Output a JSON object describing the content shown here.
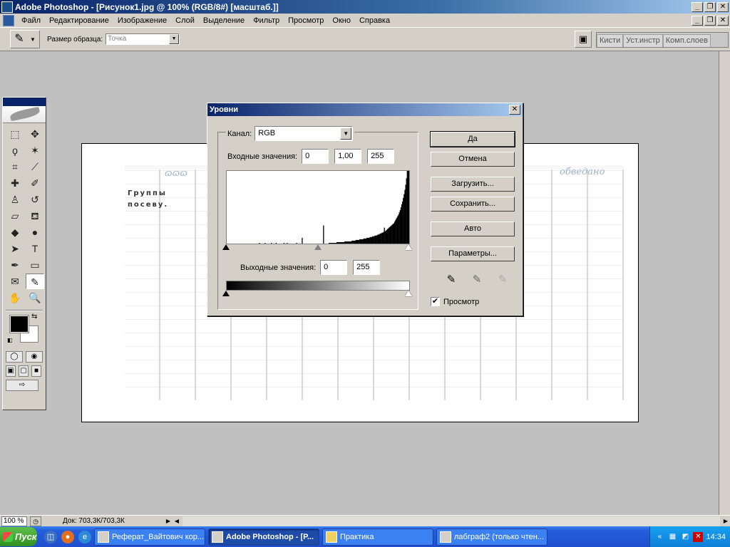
{
  "window": {
    "title": "Adobe Photoshop - [Рисунок1.jpg @ 100% (RGB/8#) [масштаб.]]",
    "minimize": "_",
    "restore": "❐",
    "close": "✕"
  },
  "menu": {
    "items": [
      "Файл",
      "Редактирование",
      "Изображение",
      "Слой",
      "Выделение",
      "Фильтр",
      "Просмотр",
      "Окно",
      "Справка"
    ]
  },
  "options": {
    "tool_icon": "eyedropper-icon",
    "tool_glyph": "✎",
    "sample_size_label": "Размер образца:",
    "sample_size_value": "Точка",
    "palette_tabs": [
      "Кисти",
      "Уст.инстр",
      "Комп.слоев"
    ]
  },
  "toolbox": {
    "tools": [
      {
        "name": "marquee-icon",
        "glyph": "⬚"
      },
      {
        "name": "move-icon",
        "glyph": "✥"
      },
      {
        "name": "lasso-icon",
        "glyph": "ϙ"
      },
      {
        "name": "magic-wand-icon",
        "glyph": "✶"
      },
      {
        "name": "crop-icon",
        "glyph": "⌗"
      },
      {
        "name": "slice-icon",
        "glyph": "⟋"
      },
      {
        "name": "healing-brush-icon",
        "glyph": "✚"
      },
      {
        "name": "brush-icon",
        "glyph": "✐"
      },
      {
        "name": "clone-stamp-icon",
        "glyph": "♙"
      },
      {
        "name": "history-brush-icon",
        "glyph": "↺"
      },
      {
        "name": "eraser-icon",
        "glyph": "▱"
      },
      {
        "name": "paint-bucket-icon",
        "glyph": "⛾"
      },
      {
        "name": "blur-icon",
        "glyph": "◆"
      },
      {
        "name": "dodge-icon",
        "glyph": "●"
      },
      {
        "name": "path-selection-icon",
        "glyph": "➤"
      },
      {
        "name": "type-icon",
        "glyph": "T"
      },
      {
        "name": "pen-icon",
        "glyph": "✒"
      },
      {
        "name": "rectangle-icon",
        "glyph": "▭"
      },
      {
        "name": "notes-icon",
        "glyph": "✉"
      },
      {
        "name": "eyedropper-tool-icon",
        "glyph": "✎",
        "active": true
      },
      {
        "name": "hand-icon",
        "glyph": "✋"
      },
      {
        "name": "zoom-icon",
        "glyph": "🔍"
      }
    ],
    "foreground_color": "#000000",
    "background_color": "#ffffff"
  },
  "document": {
    "scan_heading_1": "Группы",
    "scan_heading_2": "посеву.",
    "scan_script_left": "ɷɷɷ",
    "scan_script_right": "обведано"
  },
  "levels_dialog": {
    "title": "Уровни",
    "channel_label": "Канал:",
    "channel_value": "RGB",
    "input_label": "Входные значения:",
    "input_black": "0",
    "input_gamma": "1,00",
    "input_white": "255",
    "output_label": "Выходные значения:",
    "output_black": "0",
    "output_white": "255",
    "buttons": {
      "ok": "Да",
      "cancel": "Отмена",
      "load": "Загрузить...",
      "save": "Сохранить...",
      "auto": "Авто",
      "options": "Параметры..."
    },
    "preview_label": "Просмотр",
    "preview_checked": true,
    "histogram": [
      0,
      0,
      0,
      0,
      0,
      0,
      0,
      0,
      0,
      0,
      0,
      0,
      0,
      0,
      0,
      0,
      0,
      0,
      0,
      0,
      0,
      0,
      0,
      0,
      0,
      0,
      0,
      0,
      0,
      0,
      0,
      0,
      0,
      0,
      0,
      0,
      0,
      0,
      0,
      0,
      0,
      1,
      0,
      0,
      0,
      0,
      0,
      0,
      1,
      0,
      0,
      0,
      0,
      0,
      0,
      0,
      1,
      0,
      0,
      0,
      0,
      0,
      1,
      0,
      0,
      0,
      0,
      0,
      0,
      0,
      0,
      0,
      1,
      0,
      0,
      0,
      1,
      0,
      0,
      0,
      0,
      0,
      0,
      0,
      0,
      0,
      0,
      0,
      1,
      0,
      0,
      0,
      0,
      0,
      0,
      8,
      0,
      0,
      0,
      0,
      0,
      0,
      0,
      0,
      0,
      0,
      0,
      0,
      0,
      0,
      0,
      0,
      0,
      0,
      0,
      0,
      0,
      0,
      0,
      0,
      0,
      0,
      25,
      0,
      0,
      0,
      0,
      0,
      0,
      1,
      1,
      1,
      1,
      1,
      1,
      1,
      1,
      1,
      1,
      2,
      2,
      2,
      2,
      2,
      2,
      2,
      2,
      2,
      2,
      3,
      3,
      3,
      3,
      3,
      3,
      3,
      3,
      3,
      4,
      4,
      4,
      4,
      4,
      5,
      5,
      5,
      5,
      5,
      6,
      6,
      6,
      6,
      6,
      7,
      7,
      7,
      7,
      8,
      8,
      8,
      8,
      9,
      9,
      9,
      10,
      10,
      10,
      11,
      11,
      11,
      12,
      12,
      13,
      13,
      14,
      14,
      15,
      15,
      16,
      22,
      17,
      18,
      19,
      20,
      21,
      22,
      23,
      24,
      25,
      26,
      27,
      28,
      30,
      32,
      34,
      36,
      38,
      40,
      43,
      46,
      50,
      54,
      58,
      63,
      68,
      74,
      81,
      90,
      100,
      100,
      100
    ]
  },
  "status": {
    "zoom": "100 %",
    "doc_info": "Док: 703,3К/703,3К"
  },
  "taskbar": {
    "start_label": "Пуск",
    "tasks": [
      {
        "label": "Реферат_Вайтович кор...",
        "active": false
      },
      {
        "label": "Adobe Photoshop - [Р...",
        "active": true
      },
      {
        "label": "Практика",
        "active": false
      },
      {
        "label": "лабграф2 (только чтен...",
        "active": false
      }
    ],
    "clock": "14:34"
  }
}
